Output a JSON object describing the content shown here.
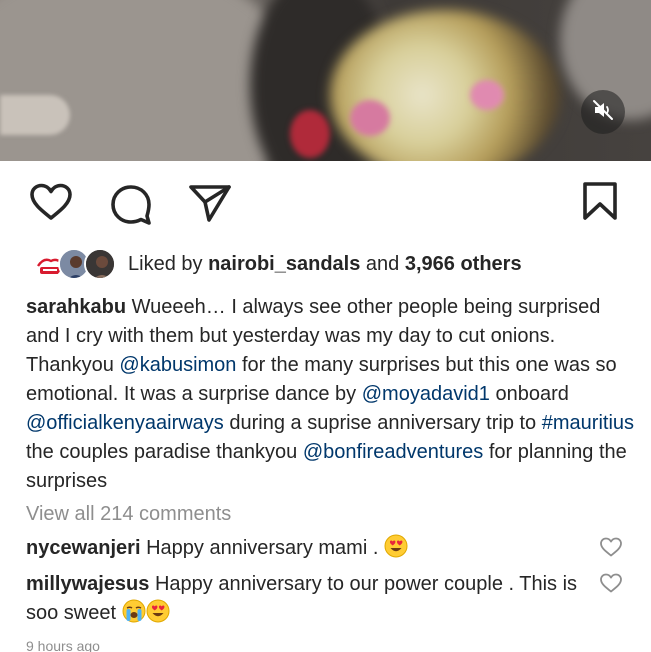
{
  "post": {
    "media": {
      "mute_icon": "speaker-muted-icon"
    },
    "actions": {
      "like_icon": "heart-icon",
      "comment_icon": "comment-icon",
      "share_icon": "paper-plane-icon",
      "save_icon": "bookmark-icon"
    },
    "likes": {
      "prefix": "Liked by",
      "user": "nairobi_sandals",
      "connector": "and",
      "others": "3,966 others"
    },
    "caption": {
      "username": "sarahkabu",
      "t1": "Wueeeh… I always see other people being surprised and I cry with them but yesterday was my day to cut onions. Thankyou",
      "m1": "@kabusimon",
      "t2": "for the many surprises but this one was so emotional. It was a surprise dance by",
      "m2": "@moyadavid1",
      "t3": "onboard",
      "m3": "@officialkenyaairways",
      "t4": "during a suprise anniversary trip to",
      "h1": "#mauritius",
      "t5": "the couples paradise thankyou",
      "m4": "@bonfireadventures",
      "t6": "for planning the surprises"
    },
    "view_all": "View all 214 comments",
    "comments": [
      {
        "username": "nycewanjeri",
        "text": "Happy anniversary mami .",
        "emoji": "heart-eyes-emoji"
      },
      {
        "username": "millywajesus",
        "text": "Happy anniversary to our power couple . This is soo sweet",
        "emoji1": "crying-emoji",
        "emoji2": "heart-eyes-emoji"
      }
    ],
    "timestamp": "9 hours ago",
    "colors": {
      "link": "#00376b",
      "muted": "#8e8e8e",
      "text": "#262626"
    }
  }
}
